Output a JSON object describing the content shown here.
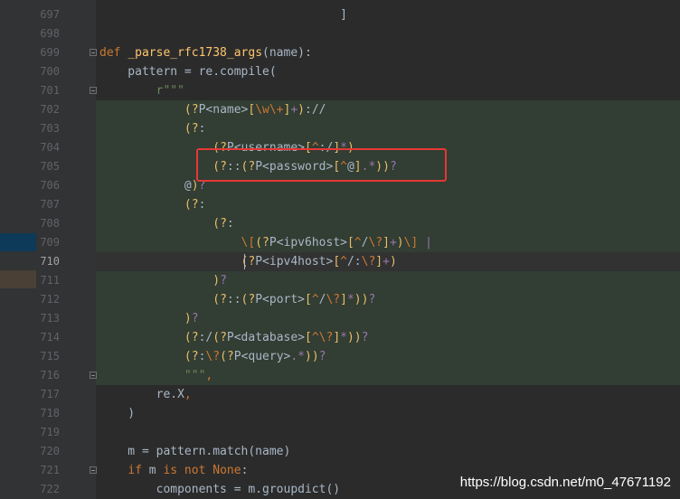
{
  "editor": {
    "lines": [
      {
        "n": "697",
        "t": "                                  ]",
        "kind": "plain"
      },
      {
        "n": "698",
        "t": "",
        "kind": "plain"
      },
      {
        "n": "699",
        "t": "def _parse_rfc1738_args(name):",
        "kind": "def"
      },
      {
        "n": "700",
        "t": "    pattern = re.compile(",
        "kind": "plain"
      },
      {
        "n": "701",
        "t": "        r\"\"\"",
        "kind": "str"
      },
      {
        "n": "702",
        "t": "            (?P<name>[\\w\\+]+)://",
        "kind": "rx"
      },
      {
        "n": "703",
        "t": "            (?:",
        "kind": "rx"
      },
      {
        "n": "704",
        "t": "                (?P<username>[^:/]*)",
        "kind": "rx"
      },
      {
        "n": "705",
        "t": "                (?::(?P<password>[^@].*))?",
        "kind": "rx"
      },
      {
        "n": "706",
        "t": "            @)?",
        "kind": "rx"
      },
      {
        "n": "707",
        "t": "            (?:",
        "kind": "rx"
      },
      {
        "n": "708",
        "t": "                (?:",
        "kind": "rx"
      },
      {
        "n": "709",
        "t": "                    \\[(?P<ipv6host>[^/\\?]+)\\] |",
        "kind": "rx"
      },
      {
        "n": "710",
        "t": "                    (?P<ipv4host>[^/:\\?]+)",
        "kind": "rx-cur"
      },
      {
        "n": "711",
        "t": "                )?",
        "kind": "rx"
      },
      {
        "n": "712",
        "t": "                (?::(?P<port>[^/\\?]*))?",
        "kind": "rx"
      },
      {
        "n": "713",
        "t": "            )?",
        "kind": "rx"
      },
      {
        "n": "714",
        "t": "            (?:/(?P<database>[^\\?]*))?",
        "kind": "rx"
      },
      {
        "n": "715",
        "t": "            (?:\\?(?P<query>.*))?",
        "kind": "rx"
      },
      {
        "n": "716",
        "t": "            \"\"\",",
        "kind": "strend"
      },
      {
        "n": "717",
        "t": "        re.X,",
        "kind": "plain"
      },
      {
        "n": "718",
        "t": "    )",
        "kind": "plain"
      },
      {
        "n": "719",
        "t": "",
        "kind": "plain"
      },
      {
        "n": "720",
        "t": "    m = pattern.match(name)",
        "kind": "plain"
      },
      {
        "n": "721",
        "t": "    if m is not None:",
        "kind": "if"
      },
      {
        "n": "722",
        "t": "        components = m.groupdict()",
        "kind": "plain"
      }
    ],
    "current_line": "710"
  },
  "watermark": "https://blog.csdn.net/m0_47671192",
  "colors": {
    "background": "#2b2b2b",
    "regex_injection_bg": "#323d33",
    "highlight_box": "#e53935",
    "keyword": "#cc7832",
    "function": "#ffc66d",
    "string": "#6a8759"
  }
}
